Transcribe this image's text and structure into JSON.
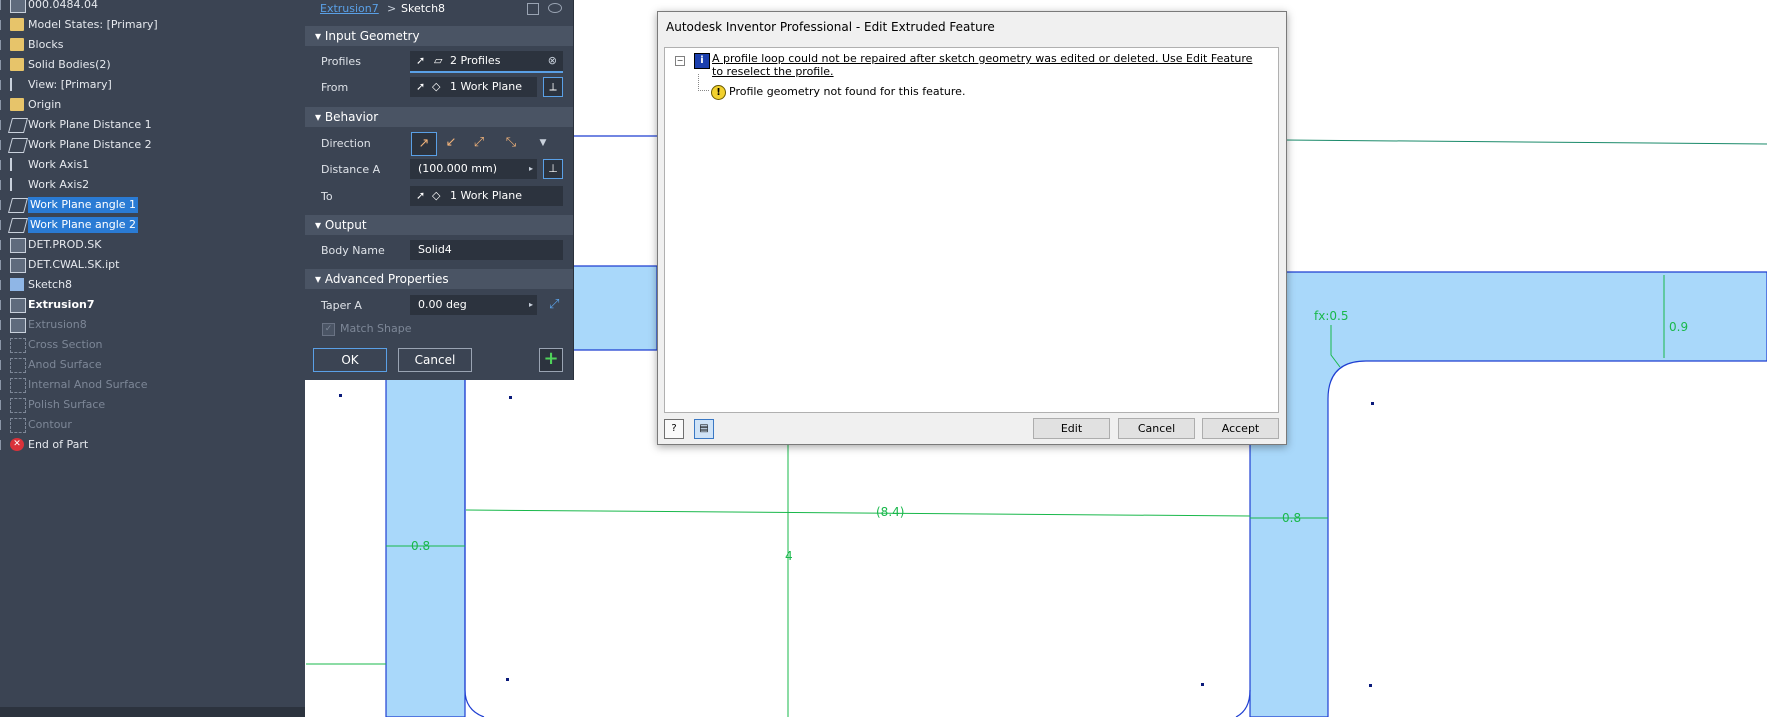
{
  "browser": {
    "items": [
      {
        "label": "000.0484.04",
        "icon": "part-icon",
        "style": "normal"
      },
      {
        "label": "Model States: [Primary]",
        "icon": "folder-icon",
        "style": "normal"
      },
      {
        "label": "Blocks",
        "icon": "blocks-icon",
        "style": "normal"
      },
      {
        "label": "Solid Bodies(2)",
        "icon": "solid-bodies-icon",
        "style": "normal"
      },
      {
        "label": "View: [Primary]",
        "icon": "view-icon",
        "style": "normal"
      },
      {
        "label": "Origin",
        "icon": "folder-icon",
        "style": "normal"
      },
      {
        "label": "Work Plane Distance 1",
        "icon": "work-plane-icon",
        "style": "normal"
      },
      {
        "label": "Work Plane Distance 2",
        "icon": "work-plane-icon",
        "style": "normal"
      },
      {
        "label": "Work Axis1",
        "icon": "work-axis-icon",
        "style": "normal"
      },
      {
        "label": "Work Axis2",
        "icon": "work-axis-icon",
        "style": "normal"
      },
      {
        "label": "Work Plane angle 1",
        "icon": "work-plane-icon",
        "style": "selected"
      },
      {
        "label": "Work Plane angle 2",
        "icon": "work-plane-icon",
        "style": "selected"
      },
      {
        "label": "DET.PROD.SK",
        "icon": "derived-part-icon",
        "style": "normal"
      },
      {
        "label": "DET.CWAL.SK.ipt",
        "icon": "derived-part-icon",
        "style": "normal"
      },
      {
        "label": "Sketch8",
        "icon": "sketch-icon",
        "style": "normal"
      },
      {
        "label": "Extrusion7",
        "icon": "extrusion-icon",
        "style": "bold"
      },
      {
        "label": "Extrusion8",
        "icon": "extrusion-icon",
        "style": "dim"
      },
      {
        "label": "Cross Section",
        "icon": "suppressed-feature-icon",
        "style": "dim"
      },
      {
        "label": "Anod Surface",
        "icon": "suppressed-feature-icon",
        "style": "dim"
      },
      {
        "label": "Internal Anod Surface",
        "icon": "suppressed-feature-icon",
        "style": "dim"
      },
      {
        "label": "Polish Surface",
        "icon": "suppressed-feature-icon",
        "style": "dim"
      },
      {
        "label": "Contour",
        "icon": "suppressed-feature-icon",
        "style": "dim"
      },
      {
        "label": "End of Part",
        "icon": "end-of-part-icon",
        "style": "normal"
      }
    ]
  },
  "panel": {
    "breadcrumb_link": "Extrusion7",
    "breadcrumb_sep": ">",
    "breadcrumb_current": "Sketch8",
    "sections": {
      "input_geometry": "Input Geometry",
      "behavior": "Behavior",
      "output": "Output",
      "advanced": "Advanced Properties"
    },
    "profiles_label": "Profiles",
    "profiles_value": "2 Profiles",
    "from_label": "From",
    "from_value": "1 Work Plane",
    "direction_label": "Direction",
    "distance_label": "Distance A",
    "distance_value": "(100.000 mm)",
    "to_label": "To",
    "to_value": "1 Work Plane",
    "body_name_label": "Body Name",
    "body_name_value": "Solid4",
    "taper_label": "Taper A",
    "taper_value": "0.00 deg",
    "match_shape_label": "Match Shape",
    "ok_label": "OK",
    "cancel_label": "Cancel",
    "plus_label": "+"
  },
  "dialog": {
    "title": "Autodesk Inventor Professional - Edit Extruded Feature",
    "message_main": "A profile loop could not be repaired after sketch geometry was edited or deleted.  Use Edit Feature to reselect the profile.",
    "message_detail": "Profile geometry not found for this feature.",
    "edit_label": "Edit",
    "cancel_label": "Cancel",
    "accept_label": "Accept"
  },
  "sketch": {
    "dim_top_left": "0.8",
    "dim_span": "(8.4)",
    "dim_vertical": "4",
    "dim_right": "0.8",
    "dim_height": "0.9",
    "dim_fillet": "fx:0.5"
  },
  "colors": {
    "panel_bg": "#3b4453",
    "selection": "#2a7bd4",
    "profile_fill": "#a9d8fa",
    "profile_edge": "#1f3fd1",
    "dimension": "#19b84b"
  }
}
